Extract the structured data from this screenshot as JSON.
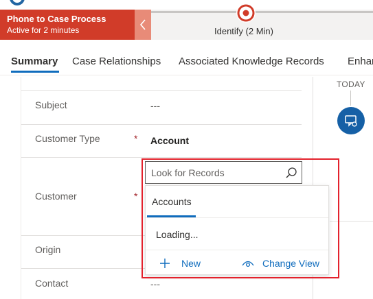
{
  "process": {
    "title": "Phone to Case Process",
    "subtitle": "Active for 2 minutes",
    "stage_label": "Identify  (2 Min)",
    "accent_color": "#d13c29"
  },
  "tabs": [
    {
      "label": "Summary",
      "active": true
    },
    {
      "label": "Case Relationships",
      "active": false
    },
    {
      "label": "Associated Knowledge Records",
      "active": false
    },
    {
      "label": "Enhanced",
      "active": false
    }
  ],
  "form": {
    "subject": {
      "label": "Subject",
      "value": "---"
    },
    "customer_type": {
      "label": "Customer Type",
      "required_marker": "*",
      "value": "Account"
    },
    "customer": {
      "label": "Customer",
      "required_marker": "*"
    },
    "origin": {
      "label": "Origin"
    },
    "contact": {
      "label": "Contact",
      "value": "---"
    }
  },
  "lookup": {
    "placeholder": "Look for Records",
    "tab_label": "Accounts",
    "loading_text": "Loading...",
    "new_label": "New",
    "change_view_label": "Change View",
    "highlight_color": "#e3212c"
  },
  "timeline": {
    "today_label": "TODAY",
    "icon": "phone-call-icon"
  }
}
